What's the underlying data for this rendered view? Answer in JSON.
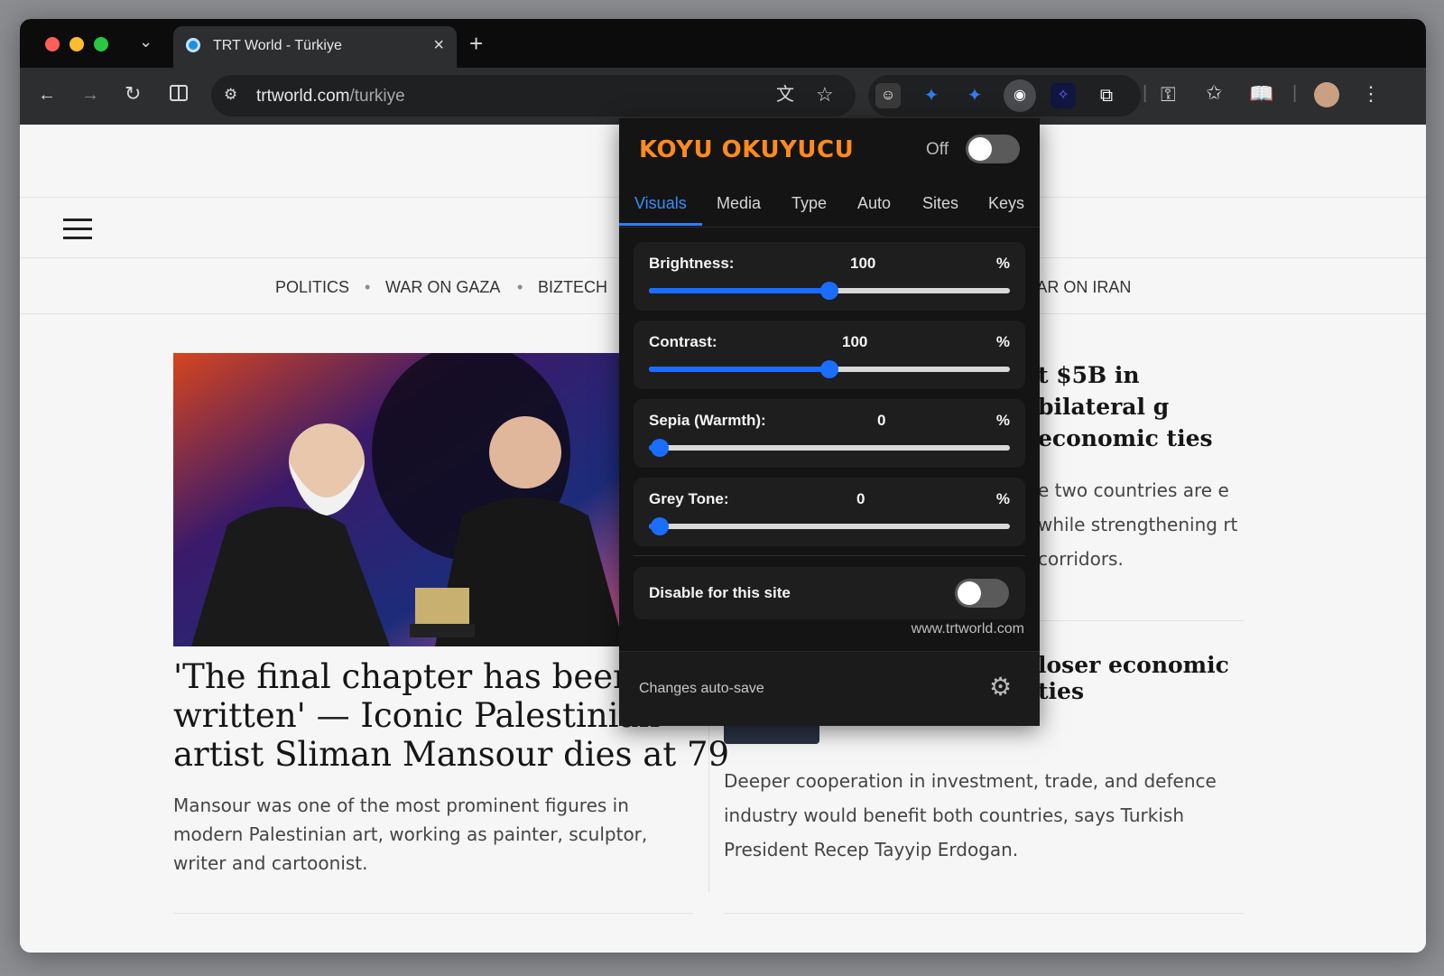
{
  "browser": {
    "tab_title": "TRT World - Türkiye",
    "url_host": "trtworld.com",
    "url_path": "/turkiye"
  },
  "site": {
    "nav": [
      "POLITICS",
      "WAR ON GAZA",
      "BIZTECH",
      "WAR ON IRAN"
    ],
    "hero_headline": "'The final chapter has been written' — Iconic Palestinian artist Sliman Mansour dies at 79",
    "hero_summary": "Mansour was one of the most prominent figures in modern Palestinian art, working as painter, sculptor, writer and cartoonist.",
    "story1_headline_fragment": "t $5B in bilateral g economic ties",
    "story1_summary_fragment": "e two countries are e while strengthening rt corridors.",
    "story2_headline_fragment": "loser economic ties",
    "story2_summary": "Deeper cooperation in investment, trade, and defence industry would benefit both countries, says Turkish President Recep Tayyip Erdogan."
  },
  "popup": {
    "brand": "KOYU OKUYUCU",
    "power_label": "Off",
    "tabs": [
      "Visuals",
      "Media",
      "Type",
      "Auto",
      "Sites",
      "Keys"
    ],
    "sliders": [
      {
        "label": "Brightness:",
        "value": "100",
        "unit": "%",
        "fraction": 0.5
      },
      {
        "label": "Contrast:",
        "value": "100",
        "unit": "%",
        "fraction": 0.5
      },
      {
        "label": "Sepia (Warmth):",
        "value": "0",
        "unit": "%",
        "fraction": 0.03
      },
      {
        "label": "Grey Tone:",
        "value": "0",
        "unit": "%",
        "fraction": 0.03
      }
    ],
    "disable_label": "Disable for this site",
    "site_host": "www.trtworld.com",
    "footer_note": "Changes auto-save"
  },
  "colors": {
    "brand": "#ff8a1f",
    "accent": "#1a6dff",
    "popup_bg": "#141414"
  }
}
